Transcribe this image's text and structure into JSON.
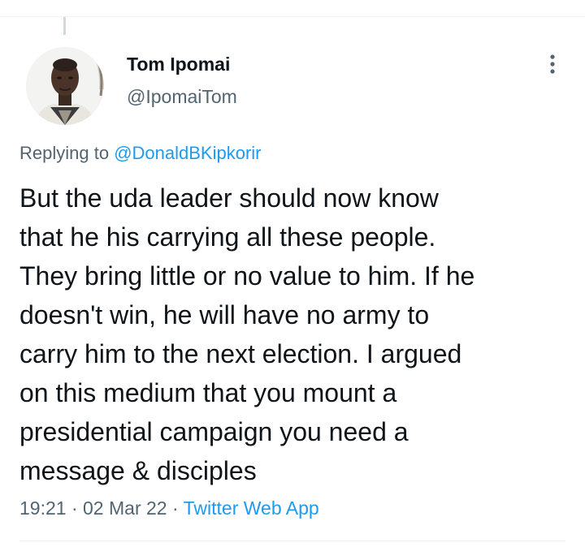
{
  "tweet": {
    "author": {
      "name": "Tom Ipomai",
      "handle": "@IpomaiTom"
    },
    "reply": {
      "prefix": "Replying to",
      "to_handle": "@DonaldBKipkorir"
    },
    "text_lines": [
      "But the uda leader should now know",
      "that he his carrying all these people.",
      "They bring little or no value to him. If he",
      "doesn't win, he will have no army to",
      "carry him to the next election. I argued",
      "on this medium that you mount a",
      "presidential campaign you need a",
      "message & disciples"
    ],
    "meta": {
      "time": "19:21",
      "date": "02 Mar 22",
      "separator": "·",
      "source": "Twitter Web App"
    }
  },
  "icons": {
    "more": "more-vertical-icon"
  },
  "colors": {
    "text_primary": "#0f1419",
    "text_secondary": "#536471",
    "link": "#1d9bf0",
    "divider": "#eff3f4"
  }
}
